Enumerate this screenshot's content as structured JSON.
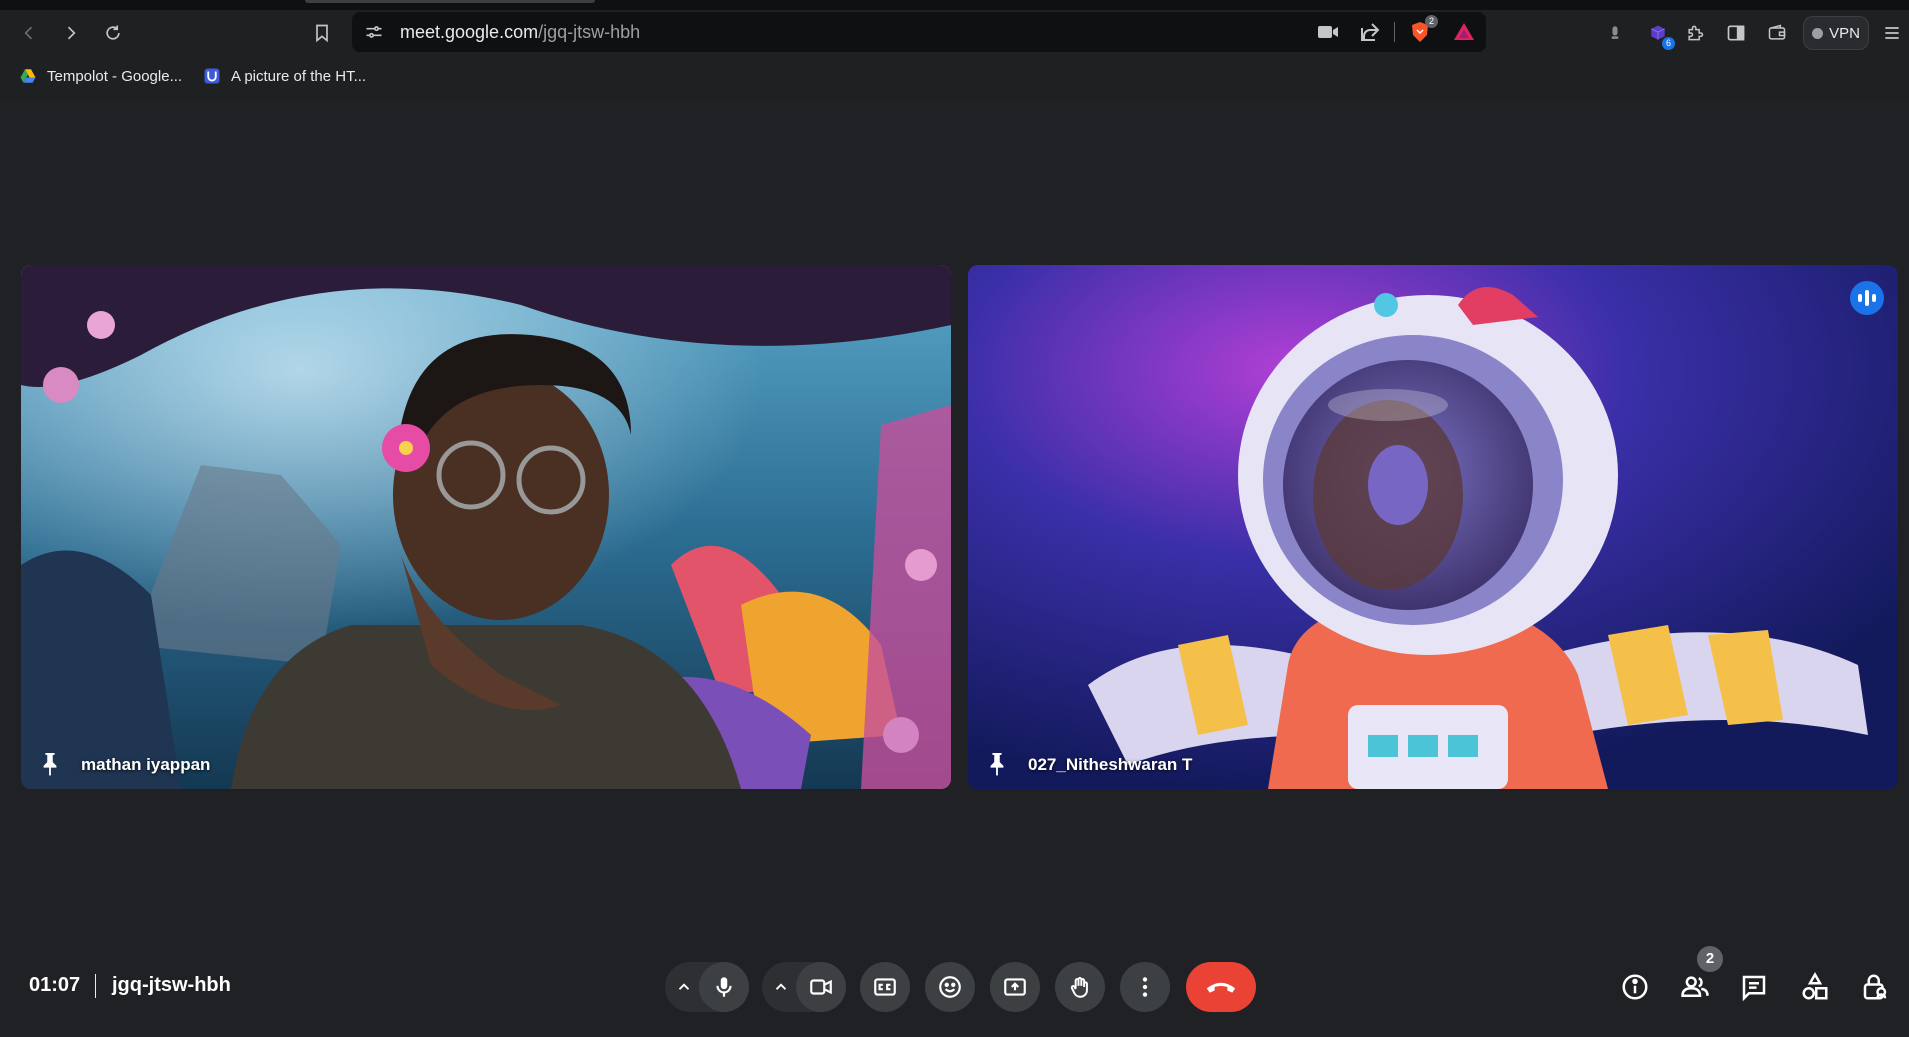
{
  "browser": {
    "url_host": "meet.google.com",
    "url_path": "/jgq-jtsw-hbh",
    "brave_badge": "2",
    "extensions_badge": "6",
    "vpn_label": "VPN",
    "icons": [
      "back-icon",
      "forward-icon",
      "reload-icon",
      "bookmark-icon",
      "site-info-icon",
      "camera-icon",
      "share-icon",
      "brave-shield-icon",
      "brave-rewards-icon",
      "puzzle-icon",
      "sidebar-icon",
      "wallet-icon",
      "menu-icon"
    ]
  },
  "bookmarks": [
    {
      "label": "Tempolot - Google...",
      "icon": "google-drive-icon"
    },
    {
      "label": "A picture of the HT...",
      "icon": "u-logo-icon"
    }
  ],
  "tiles": [
    {
      "name": "mathan iyappan",
      "pinned_icon": "pin-icon"
    },
    {
      "name": "027_Nitheshwaran T",
      "pinned_icon": "pin-icon",
      "speaking": true
    }
  ],
  "meeting": {
    "time": "01:07",
    "code": "jgq-jtsw-hbh",
    "participants_count": "2"
  },
  "colors": {
    "background": "#202124",
    "control": "#3c4043",
    "end_call": "#ea4335",
    "speaking_indicator": "#1a73e8"
  }
}
